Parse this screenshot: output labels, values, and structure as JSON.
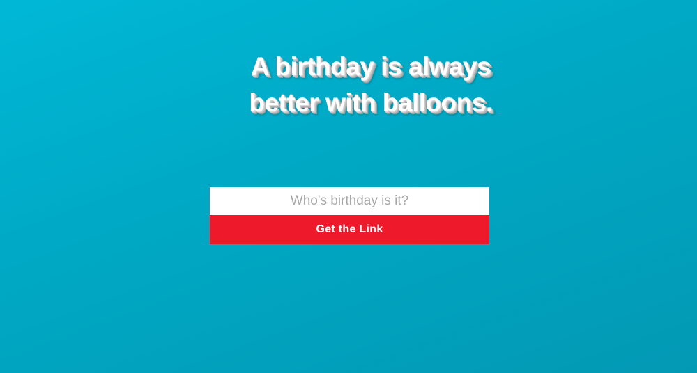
{
  "hero": {
    "line1": "A birthday is always",
    "line2": "better with balloons."
  },
  "form": {
    "name_placeholder": "Who's birthday is it?",
    "name_value": "",
    "submit_label": "Get the Link"
  },
  "colors": {
    "background": "#00a8c4",
    "button": "#ee1a2c",
    "headline": "#ffffff"
  }
}
